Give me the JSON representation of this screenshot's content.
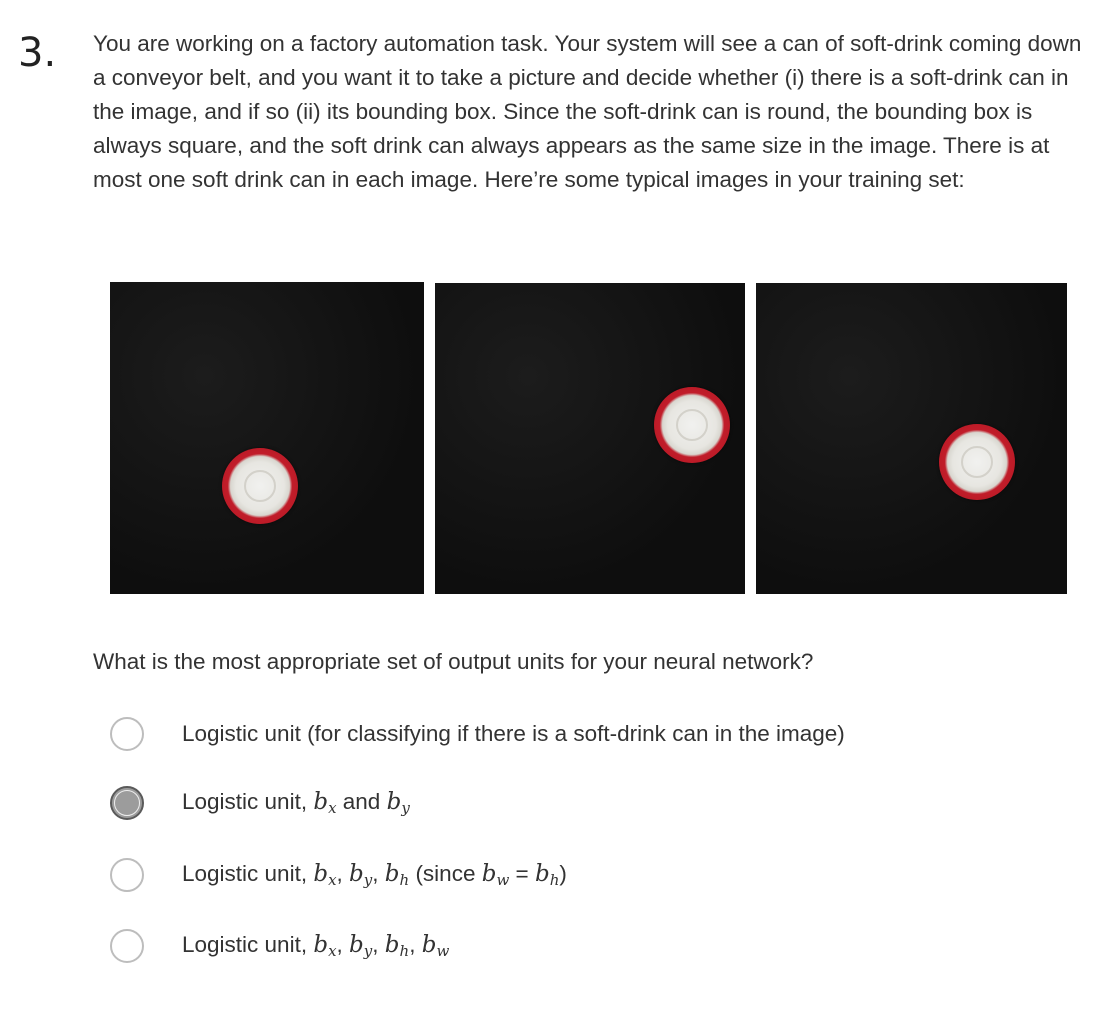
{
  "question": {
    "number": "3.",
    "prompt": "You are working on a factory automation task. Your system will see a can of soft-drink coming down a conveyor belt, and you want it to take a picture and decide whether (i) there is a soft-drink can in the image, and if so (ii) its bounding box. Since the soft-drink can is round, the bounding box is always square, and the soft drink can always appears as the same size in the image. There is at most one soft drink can in each image. Here’re some typical images in your training set:",
    "sub_question": "What is the most appropriate set of output units for your neural network?"
  },
  "images": [
    {
      "name": "training-image-1",
      "content": "soda can on black background"
    },
    {
      "name": "training-image-2",
      "content": "soda can on black background"
    },
    {
      "name": "training-image-3",
      "content": "soda can on black background"
    }
  ],
  "options": [
    {
      "label": "Logistic unit (for classifying if there is a soft-drink can in the image)",
      "selected": false
    },
    {
      "label_prefix": "Logistic unit, ",
      "b": "b",
      "x": "x",
      "y": "y",
      "and": " and ",
      "selected": true
    },
    {
      "label_prefix": "Logistic unit, ",
      "b": "b",
      "x": "x",
      "y": "y",
      "h": "h",
      "w": "w",
      "since": " (since ",
      "eq": " = ",
      "close": ")",
      "selected": false
    },
    {
      "label_prefix": "Logistic unit, ",
      "b": "b",
      "x": "x",
      "y": "y",
      "h": "h",
      "w": "w",
      "selected": false
    }
  ]
}
